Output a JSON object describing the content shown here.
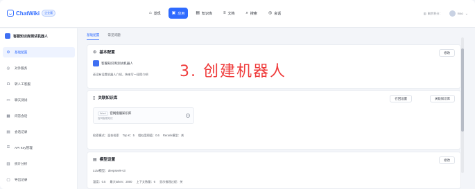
{
  "brand": {
    "name": "ChatWiki",
    "badge": "企业版"
  },
  "topnav": [
    {
      "label": "发现",
      "icon": "⌂"
    },
    {
      "label": "应用",
      "icon": "▣",
      "active": true
    },
    {
      "label": "知识库",
      "icon": "▤"
    },
    {
      "label": "文档",
      "icon": "≡"
    },
    {
      "label": "搜索",
      "icon": "⌕"
    },
    {
      "label": "会话",
      "icon": "◎"
    }
  ],
  "header_right": {
    "credit": "剩余积分：",
    "user": "mao"
  },
  "sidebar": {
    "robot_name": "客服知识库测试机器人",
    "items": [
      {
        "label": "基础配置",
        "icon": "⚙",
        "active": true
      },
      {
        "label": "对外服务",
        "icon": "◎"
      },
      {
        "label": "转人工客服",
        "icon": "☊"
      },
      {
        "label": "聊天测试",
        "icon": "▭"
      },
      {
        "label": "问答会话",
        "icon": "▦"
      },
      {
        "label": "会话记录",
        "icon": "▤"
      },
      {
        "label": "API Key管理",
        "icon": "⚿"
      },
      {
        "label": "统计分析",
        "icon": "▥"
      },
      {
        "label": "导出记录",
        "icon": "▢"
      }
    ]
  },
  "tabs": {
    "basic": "基础配置",
    "faq": "常见问题"
  },
  "card_basic": {
    "title": "基本配置",
    "edit": "修改",
    "robot_name": "客服知识库测试机器人",
    "intro": "还没有设置机器人介绍，快来写一段简介吧"
  },
  "overlay_text": "3. 创建机器人",
  "card_kb": {
    "title": "关联知识库",
    "btn_retrieval": "召回设置",
    "btn_link": "关联知识库",
    "kb_tag": "Word",
    "kb_name": "官网客服知识库",
    "kb_desc": "官网客服知识",
    "retrieval": {
      "mode": "检索模式：混合检索",
      "topk": "Top K：5",
      "threshold": "相似度阈值：0.6",
      "rerank": "Rerank模型：关"
    }
  },
  "card_model": {
    "title": "模型设置",
    "edit": "修改",
    "llm": "LLM模型：deepseek-v3",
    "params": {
      "temperature": "温度：0.5",
      "max_token": "最大token：2000",
      "context": "上下文数量：6",
      "show_reasoning": "显示推理过程：关"
    }
  }
}
